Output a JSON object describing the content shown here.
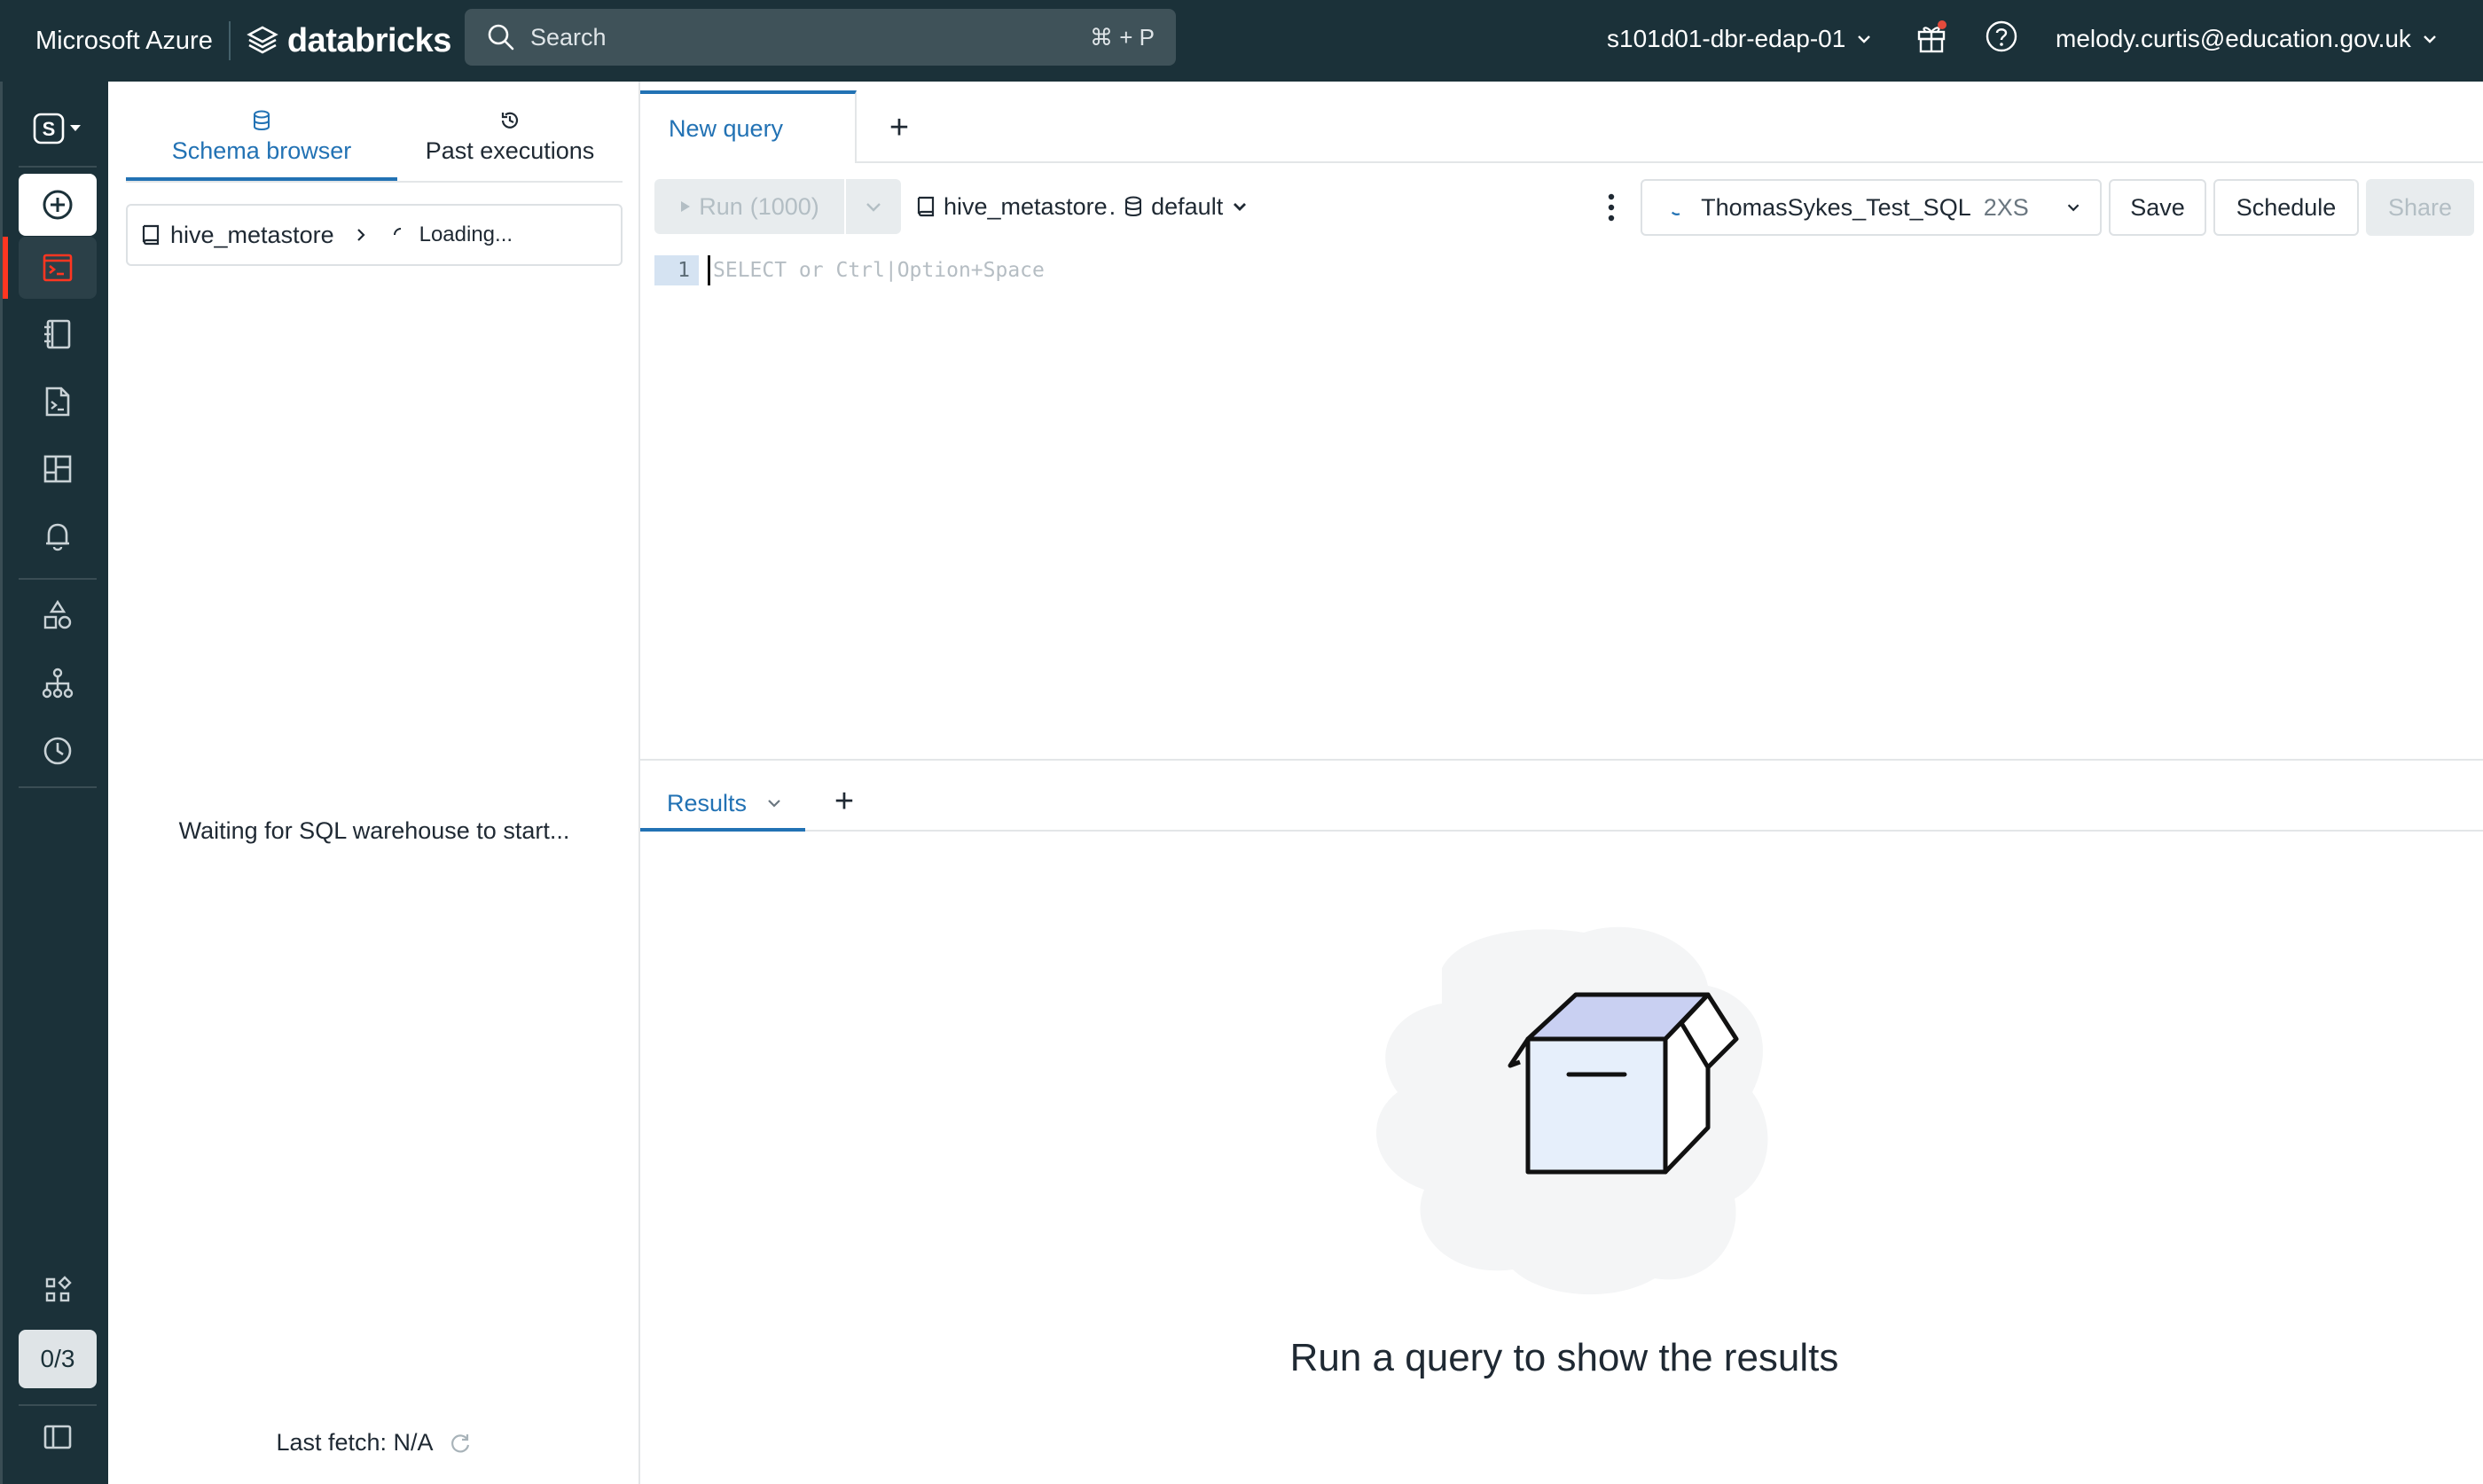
{
  "topbar": {
    "brand": "Microsoft Azure",
    "product": "databricks",
    "search_placeholder": "Search",
    "search_shortcut": "⌘ + P",
    "workspace": "s101d01-dbr-edap-01",
    "user": "melody.curtis@education.gov.uk"
  },
  "rail": {
    "workspace_switcher": "S",
    "quota": "0/3",
    "items": [
      "new",
      "sql-editor",
      "queries",
      "workflows",
      "dashboards",
      "alerts",
      "catalog",
      "models",
      "query-history",
      "marketplace",
      "collapse"
    ]
  },
  "schema_panel": {
    "tabs": [
      "Schema browser",
      "Past executions"
    ],
    "catalog": "hive_metastore",
    "loading": "Loading...",
    "waiting": "Waiting for SQL warehouse to start...",
    "last_fetch": "Last fetch: N/A"
  },
  "editor": {
    "tab_label": "New query",
    "add_tab": "+",
    "run_label": "Run",
    "run_limit": "(1000)",
    "catalog": "hive_metastore",
    "catalog_dot": ".",
    "schema": "default",
    "warehouse": "ThomasSykes_Test_SQL",
    "warehouse_size": "2XS",
    "save": "Save",
    "schedule": "Schedule",
    "share": "Share",
    "line_number": "1",
    "placeholder": "SELECT or Ctrl|Option+Space"
  },
  "results": {
    "tab_label": "Results",
    "add_tab": "+",
    "empty_message": "Run a query to show the results"
  },
  "colors": {
    "topbar": "#1b3139",
    "accent": "#2272b4",
    "active_marker": "#ff3621",
    "notification_dot": "#e44b3c"
  }
}
